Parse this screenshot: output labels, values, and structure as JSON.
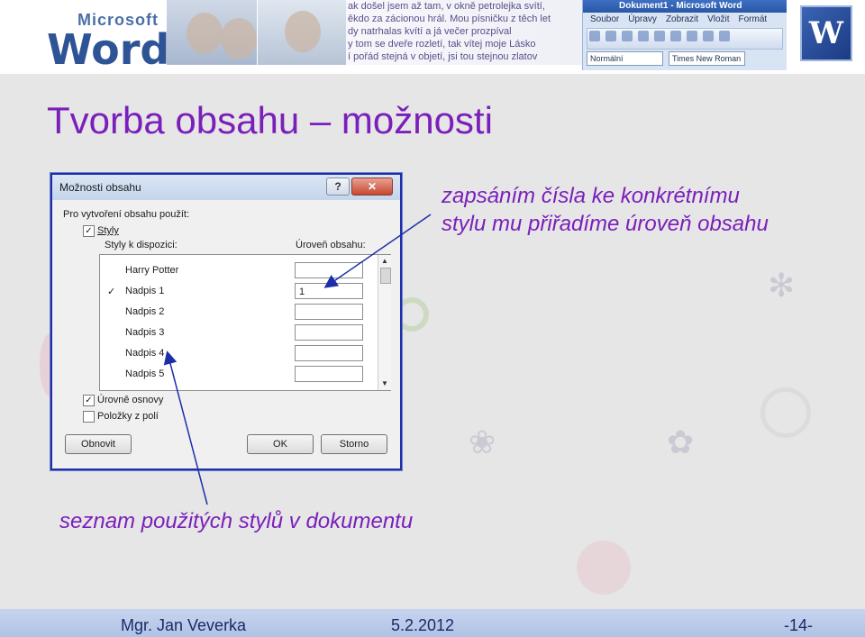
{
  "banner": {
    "logo_top": "Microsoft",
    "logo_bottom": "Word",
    "poem_lines": [
      "ak došel jsem až tam, v okně petrolejka svítí,",
      "ěkdo za zácionou hrál. Mou písničku z těch let",
      "dy natrhalas kvítí a já večer prozpíval",
      "y tom se dveře rozletí, tak vítej moje Lásko",
      "í pořád stejná v objetí, jsi tou stejnou zlatov"
    ],
    "word_title": "Dokument1 - Microsoft Word",
    "word_menu": [
      "Soubor",
      "Úpravy",
      "Zobrazit",
      "Vložit",
      "Formát"
    ],
    "style_field": "Normální",
    "font_field": "Times New Roman",
    "word_logo_letter": "W"
  },
  "title": "Tvorba obsahu – možnosti",
  "dialog": {
    "title": "Možnosti obsahu",
    "help_btn": "?",
    "close_btn": "✕",
    "build_label": "Pro vytvoření obsahu použít:",
    "styles_checkbox": {
      "label": "Styly",
      "checked": true
    },
    "available_styles_label": "Styly k dispozici:",
    "toc_level_label": "Úroveň obsahu:",
    "styles": [
      {
        "name": "Harry Potter",
        "checked": false,
        "level": ""
      },
      {
        "name": "Nadpis 1",
        "checked": true,
        "level": "1"
      },
      {
        "name": "Nadpis 2",
        "checked": false,
        "level": ""
      },
      {
        "name": "Nadpis 3",
        "checked": false,
        "level": ""
      },
      {
        "name": "Nadpis 4",
        "checked": false,
        "level": ""
      },
      {
        "name": "Nadpis 5",
        "checked": false,
        "level": ""
      }
    ],
    "outline_levels": {
      "label": "Úrovně osnovy",
      "checked": true
    },
    "field_entries": {
      "label": "Položky z polí",
      "checked": false
    },
    "reset_button": "Obnovit",
    "ok_button": "OK",
    "cancel_button": "Storno"
  },
  "annotations": {
    "top": "zapsáním čísla ke konkrétnímu stylu mu přiřadíme úroveň obsahu",
    "bottom": "seznam použitých stylů v dokumentu"
  },
  "footer": {
    "author": "Mgr. Jan Veverka",
    "date": "5.2.2012",
    "page": "-14-"
  },
  "colors": {
    "title_purple": "#7a1fbb",
    "arrow_blue": "#1d2fa8",
    "footer_bg": "#b0c3e6"
  }
}
